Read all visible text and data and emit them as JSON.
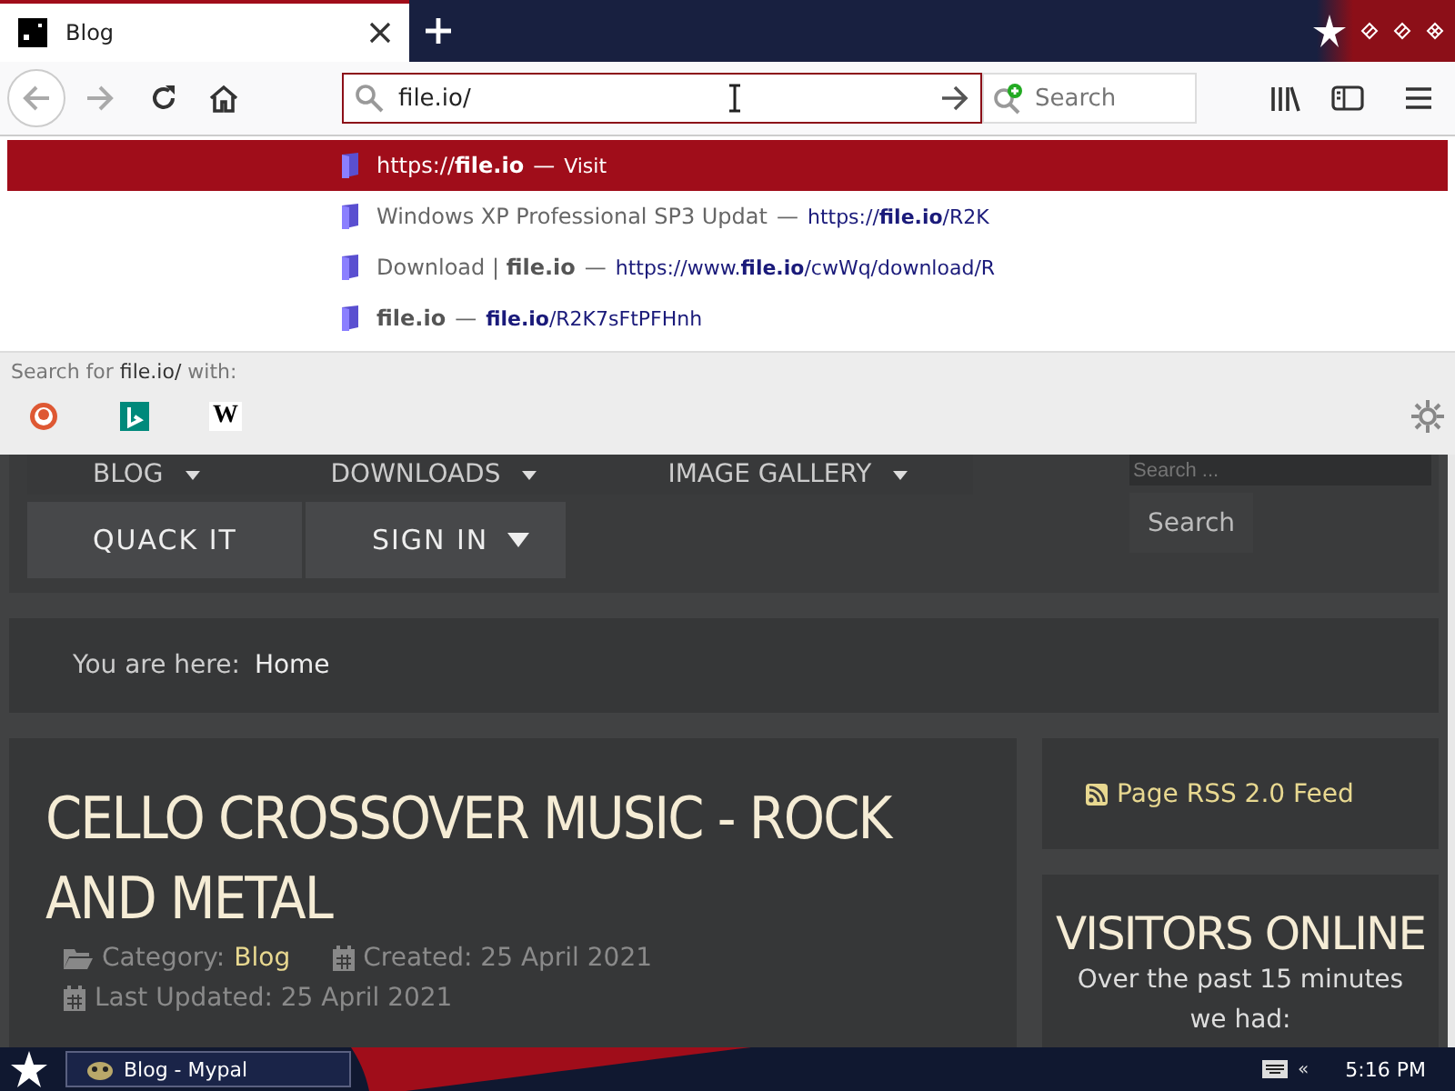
{
  "tabs": [
    {
      "title": "Blog",
      "selected": true
    }
  ],
  "toolbar": {
    "back_disabled": true,
    "forward_disabled": true,
    "url": "file.io/",
    "search": {
      "placeholder": "Search"
    }
  },
  "suggestions": [
    {
      "title": "https://**file.io**",
      "separator": "—",
      "url": "Visit",
      "selected": true
    },
    {
      "title": "Windows XP Professional SP3 Updat",
      "separator": "—",
      "url": "https://**file.io**/R2K",
      "selected": false
    },
    {
      "title": "Download | **file.io**",
      "separator": "—",
      "url": "https://www.**file.io**/cwWq/download/R",
      "selected": false
    },
    {
      "title": "**file.io**",
      "separator": "—",
      "url": "**file.io**/R2K7sFtPFHnh",
      "selected": false
    }
  ],
  "search_with": {
    "label": "Search for **file.io/** with:",
    "engines": [
      {
        "kind": "duckduckgo"
      },
      {
        "kind": "bing"
      },
      {
        "kind": "wikipedia",
        "label": "W"
      }
    ]
  },
  "page": {
    "nav_row_1": [
      "BLOG",
      "DOWNLOADS",
      "IMAGE GALLERY"
    ],
    "nav_row_2": [
      {
        "label": "QUACK IT",
        "dropdown": false
      },
      {
        "label": "SIGN IN",
        "dropdown": true
      }
    ],
    "site_search": {
      "placeholder": "Search ...",
      "button": "Search"
    },
    "breadcrumb": {
      "label": "You are here:",
      "current": "Home"
    },
    "article": {
      "title": "CELLO CROSSOVER MUSIC - ROCK AND METAL",
      "category_label": "Category:",
      "category": "Blog",
      "created": "Created: 25 April 2021",
      "updated": "Last Updated: 25 April 2021"
    },
    "rss": "Page RSS 2.0 Feed",
    "visitors": {
      "title": "VISITORS ONLINE",
      "text": "Over the past 15 minutes we had:"
    }
  },
  "taskbar": {
    "window": "Blog - Mypal",
    "tray_expand": "«",
    "time": "5:16 PM"
  }
}
